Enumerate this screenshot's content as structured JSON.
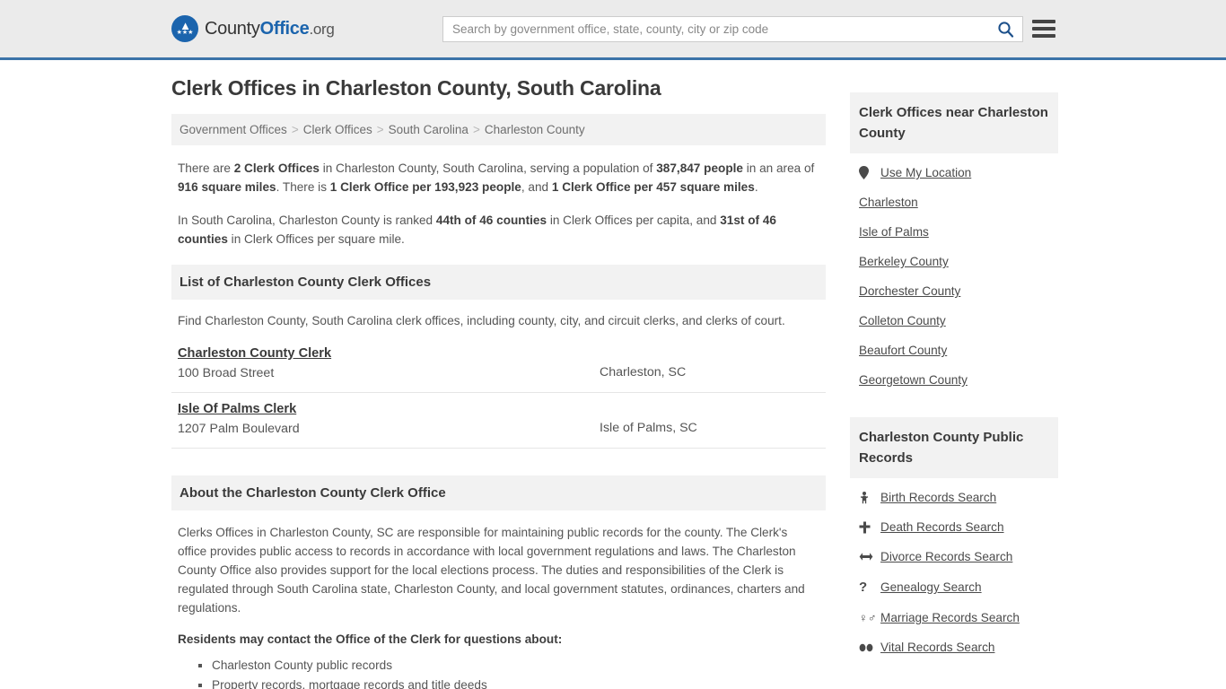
{
  "header": {
    "logo": {
      "part1": "County",
      "part2": "Office",
      "part3": ".org",
      "icon": "eagle-seal-icon"
    },
    "search": {
      "placeholder": "Search by government office, state, county, city or zip code",
      "value": "",
      "search_icon": "search-icon"
    },
    "menu_icon": "hamburger-menu-icon",
    "accent_color": "#3b73a8",
    "background_color": "#ebebeb"
  },
  "main": {
    "page_title": "Clerk Offices in Charleston County, South Carolina",
    "breadcrumb": {
      "separator": ">",
      "items": [
        {
          "label": "Government Offices"
        },
        {
          "label": "Clerk Offices"
        },
        {
          "label": "South Carolina"
        },
        {
          "label": "Charleston County"
        }
      ]
    },
    "intro_paragraph_1": {
      "segments": [
        {
          "text": "There are ",
          "bold": false
        },
        {
          "text": "2 Clerk Offices",
          "bold": true
        },
        {
          "text": " in Charleston County, South Carolina, serving a population of ",
          "bold": false
        },
        {
          "text": "387,847 people",
          "bold": true
        },
        {
          "text": " in an area of ",
          "bold": false
        },
        {
          "text": "916 square miles",
          "bold": true
        },
        {
          "text": ". There is ",
          "bold": false
        },
        {
          "text": "1 Clerk Office per 193,923 people",
          "bold": true
        },
        {
          "text": ", and ",
          "bold": false
        },
        {
          "text": "1 Clerk Office per 457 square miles",
          "bold": true
        },
        {
          "text": ".",
          "bold": false
        }
      ]
    },
    "intro_paragraph_2": {
      "segments": [
        {
          "text": "In South Carolina, Charleston County is ranked ",
          "bold": false
        },
        {
          "text": "44th of 46 counties",
          "bold": true
        },
        {
          "text": " in Clerk Offices per capita, and ",
          "bold": false
        },
        {
          "text": "31st of 46 counties",
          "bold": true
        },
        {
          "text": " in Clerk Offices per square mile.",
          "bold": false
        }
      ]
    },
    "list_section": {
      "heading": "List of Charleston County Clerk Offices",
      "description": "Find Charleston County, South Carolina clerk offices, including county, city, and circuit clerks, and clerks of court.",
      "offices": [
        {
          "name": "Charleston County Clerk",
          "address": "100 Broad Street",
          "city_state": "Charleston, SC"
        },
        {
          "name": "Isle Of Palms Clerk",
          "address": "1207 Palm Boulevard",
          "city_state": "Isle of Palms, SC"
        }
      ]
    },
    "about_section": {
      "heading": "About the Charleston County Clerk Office",
      "paragraph": "Clerks Offices in Charleston County, SC are responsible for maintaining public records for the county. The Clerk's office provides public access to records in accordance with local government regulations and laws. The Charleston County Office also provides support for the local elections process. The duties and responsibilities of the Clerk is regulated through South Carolina state, Charleston County, and local government statutes, ordinances, charters and regulations.",
      "contact_heading": "Residents may contact the Office of the Clerk for questions about:",
      "bullets": [
        "Charleston County public records",
        "Property records, mortgage records and title deeds"
      ]
    }
  },
  "sidebar": {
    "near_panel": {
      "heading": "Clerk Offices near Charleston County",
      "items": [
        {
          "label": "Use My Location",
          "icon": "map-pin-icon"
        },
        {
          "label": "Charleston",
          "icon": ""
        },
        {
          "label": "Isle of Palms",
          "icon": ""
        },
        {
          "label": "Berkeley County",
          "icon": ""
        },
        {
          "label": "Dorchester County",
          "icon": ""
        },
        {
          "label": "Colleton County",
          "icon": ""
        },
        {
          "label": "Beaufort County",
          "icon": ""
        },
        {
          "label": "Georgetown County",
          "icon": ""
        }
      ]
    },
    "records_panel": {
      "heading": "Charleston County Public Records",
      "items": [
        {
          "label": "Birth Records Search",
          "icon": "baby-icon"
        },
        {
          "label": "Death Records Search",
          "icon": "cross-icon"
        },
        {
          "label": "Divorce Records Search",
          "icon": "left-right-arrow-icon"
        },
        {
          "label": "Genealogy Search",
          "icon": "question-mark-icon"
        },
        {
          "label": "Marriage Records Search",
          "icon": "venus-mars-icon"
        },
        {
          "label": "Vital Records Search",
          "icon": "footprints-icon"
        }
      ]
    }
  }
}
